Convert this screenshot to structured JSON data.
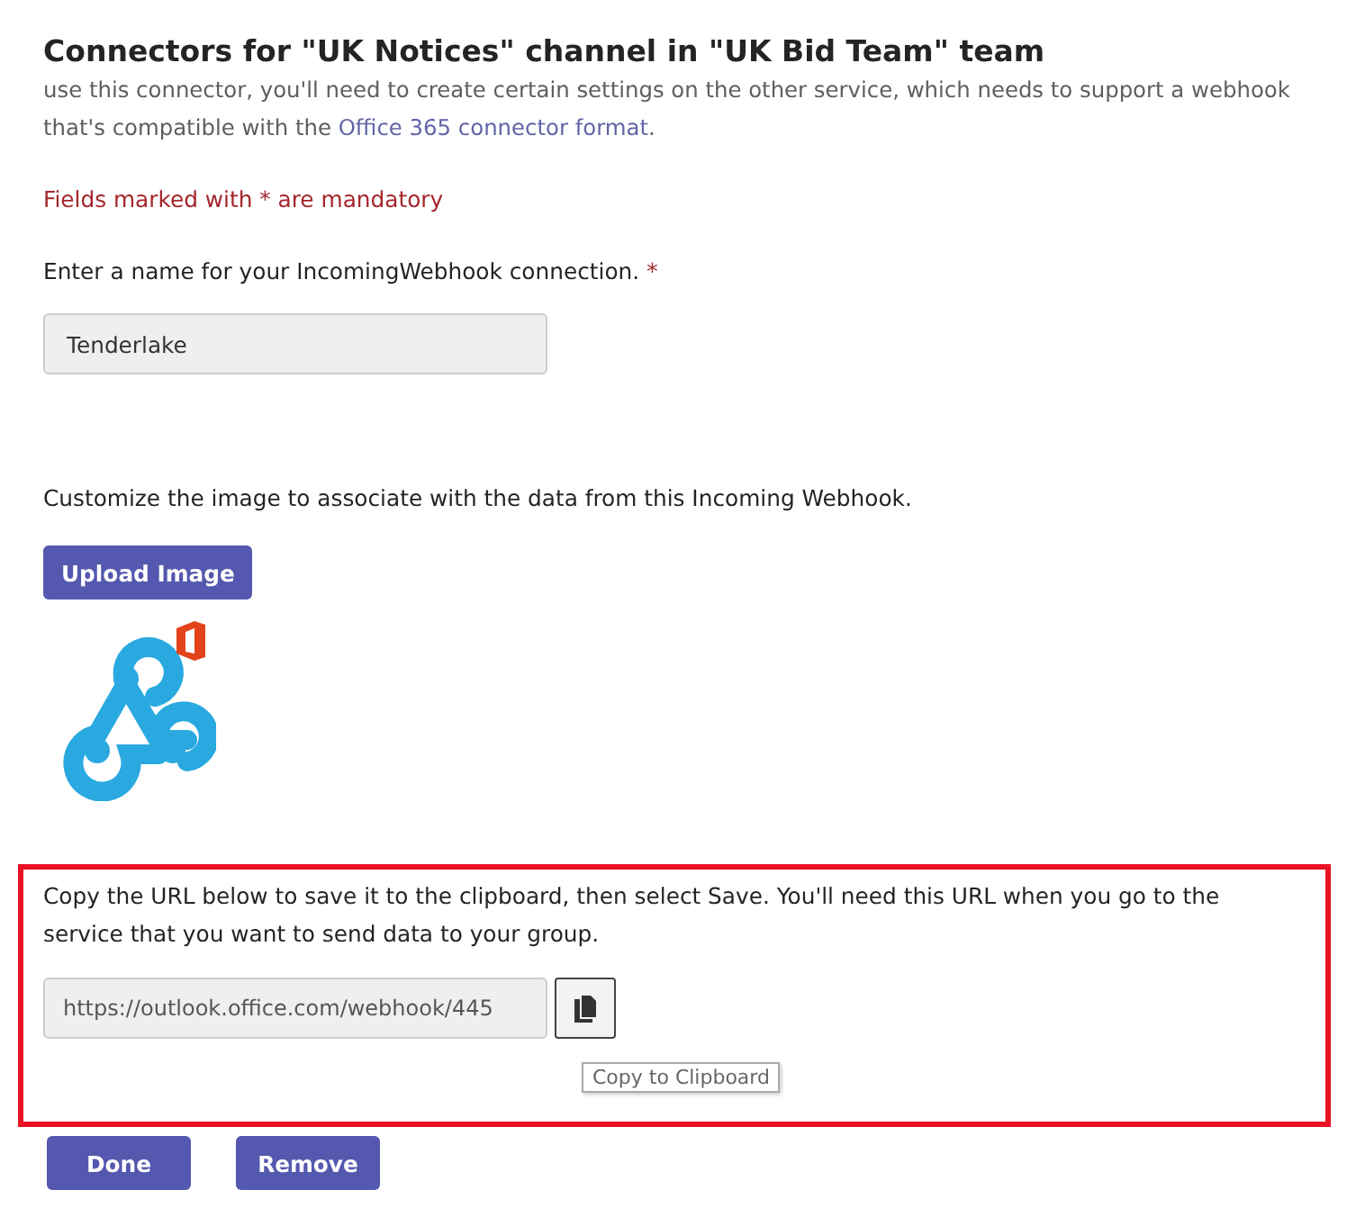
{
  "title": "Connectors for \"UK Notices\" channel in \"UK Bid Team\" team",
  "description": {
    "text": "use this connector, you'll need to create certain settings on the other service, which needs to support a webhook that's compatible with the ",
    "link": "Office 365 connector format",
    "after": "."
  },
  "mandatory_note": "Fields marked with * are mandatory",
  "name_field": {
    "label": "Enter a name for your IncomingWebhook connection.",
    "required_mark": "*",
    "value": "Tenderlake"
  },
  "image_label": "Customize the image to associate with the data from this Incoming Webhook.",
  "upload_button": "Upload Image",
  "url_section": {
    "text": "Copy the URL below to save it to the clipboard, then select Save. You'll need this URL when you go to the service that you want to send data to your group.",
    "url": "https://outlook.office.com/webhook/445",
    "tooltip": "Copy to Clipboard"
  },
  "buttons": [
    "Done",
    "Remove"
  ]
}
